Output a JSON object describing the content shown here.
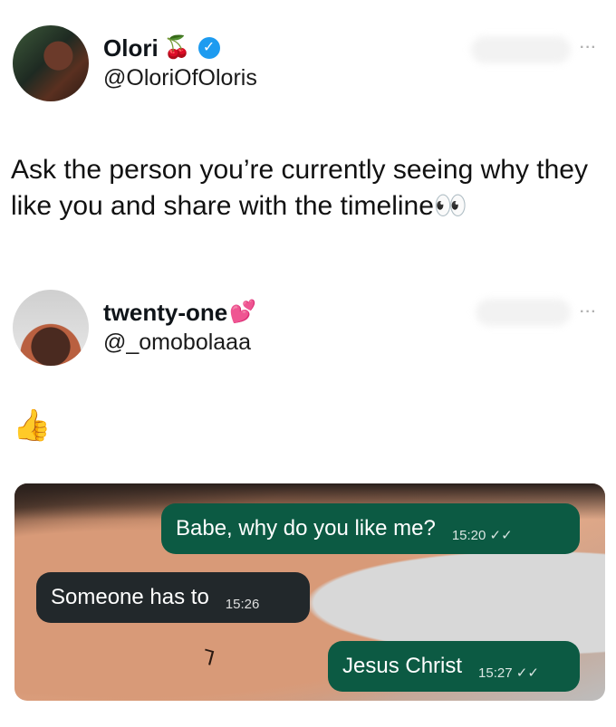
{
  "tweet": {
    "author": {
      "name": "Olori",
      "emoji": "🍒",
      "handle": "@OloriOfOloris",
      "verified_glyph": "✓",
      "more": "···"
    },
    "text": "Ask the person you’re currently seeing why they like you and share with the timeline👀"
  },
  "reply": {
    "author": {
      "name": "twenty-one",
      "emoji": "💕",
      "handle": "@_omobolaaa",
      "more": "···"
    },
    "text": "👍"
  },
  "chat": {
    "messages": [
      {
        "side": "sent",
        "text": "Babe, why do you like me?",
        "time": "15:20",
        "ticks": "✓✓"
      },
      {
        "side": "received",
        "text": "Someone has to",
        "time": "15:26"
      },
      {
        "side": "sent",
        "text": "Jesus Christ",
        "time": "15:27",
        "ticks": "✓✓"
      }
    ],
    "tattoo": "⅂"
  },
  "colors": {
    "sent_bubble": "#0c5a43",
    "received_bubble": "#22282b",
    "verified": "#1d9bf0"
  }
}
